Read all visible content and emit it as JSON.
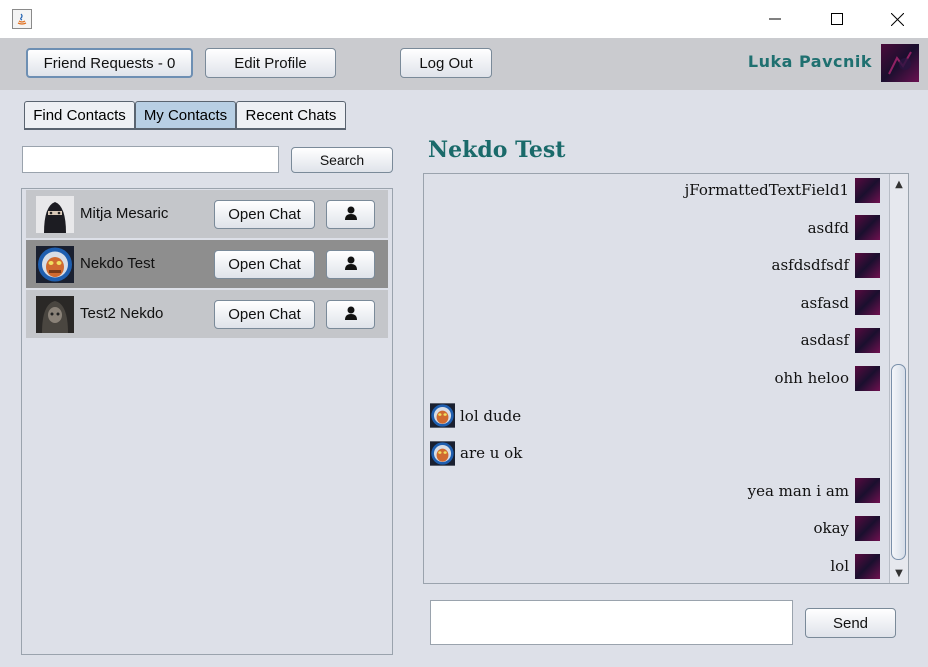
{
  "window": {
    "minimize_glyph": "─",
    "maximize_glyph": "☐",
    "close_glyph": "✕"
  },
  "header": {
    "friend_requests_label": "Friend Requests - 0",
    "edit_profile_label": "Edit Profile",
    "logout_label": "Log Out",
    "username": "Luka Pavcnik"
  },
  "tabs": {
    "find_contacts": "Find Contacts",
    "my_contacts": "My Contacts",
    "recent_chats": "Recent Chats",
    "active": "my_contacts"
  },
  "search": {
    "value": "",
    "button_label": "Search"
  },
  "contacts": [
    {
      "name": "Mitja Mesaric",
      "open_chat_label": "Open Chat",
      "selected": false,
      "avatar_icon": "masked-person-avatar"
    },
    {
      "name": "Nekdo Test",
      "open_chat_label": "Open Chat",
      "selected": true,
      "avatar_icon": "admiral-avatar"
    },
    {
      "name": "Test2 Nekdo",
      "open_chat_label": "Open Chat",
      "selected": false,
      "avatar_icon": "hooded-figure-avatar"
    }
  ],
  "chat": {
    "title": "Nekdo Test",
    "messages": [
      {
        "text": "jFormattedTextField1",
        "mine": true
      },
      {
        "text": "asdfd",
        "mine": true
      },
      {
        "text": "asfdsdfsdf",
        "mine": true
      },
      {
        "text": "asfasd",
        "mine": true
      },
      {
        "text": "asdasf",
        "mine": true
      },
      {
        "text": "ohh heloo",
        "mine": true
      },
      {
        "text": "lol dude",
        "mine": false
      },
      {
        "text": "are u ok",
        "mine": false
      },
      {
        "text": "yea man i am",
        "mine": true
      },
      {
        "text": "okay",
        "mine": true
      },
      {
        "text": "lol",
        "mine": true
      }
    ],
    "input_value": "",
    "send_label": "Send"
  },
  "colors": {
    "accent_teal": "#1f7070",
    "selected_row": "#8e8e8e",
    "active_tab": "#b8cfe4"
  }
}
